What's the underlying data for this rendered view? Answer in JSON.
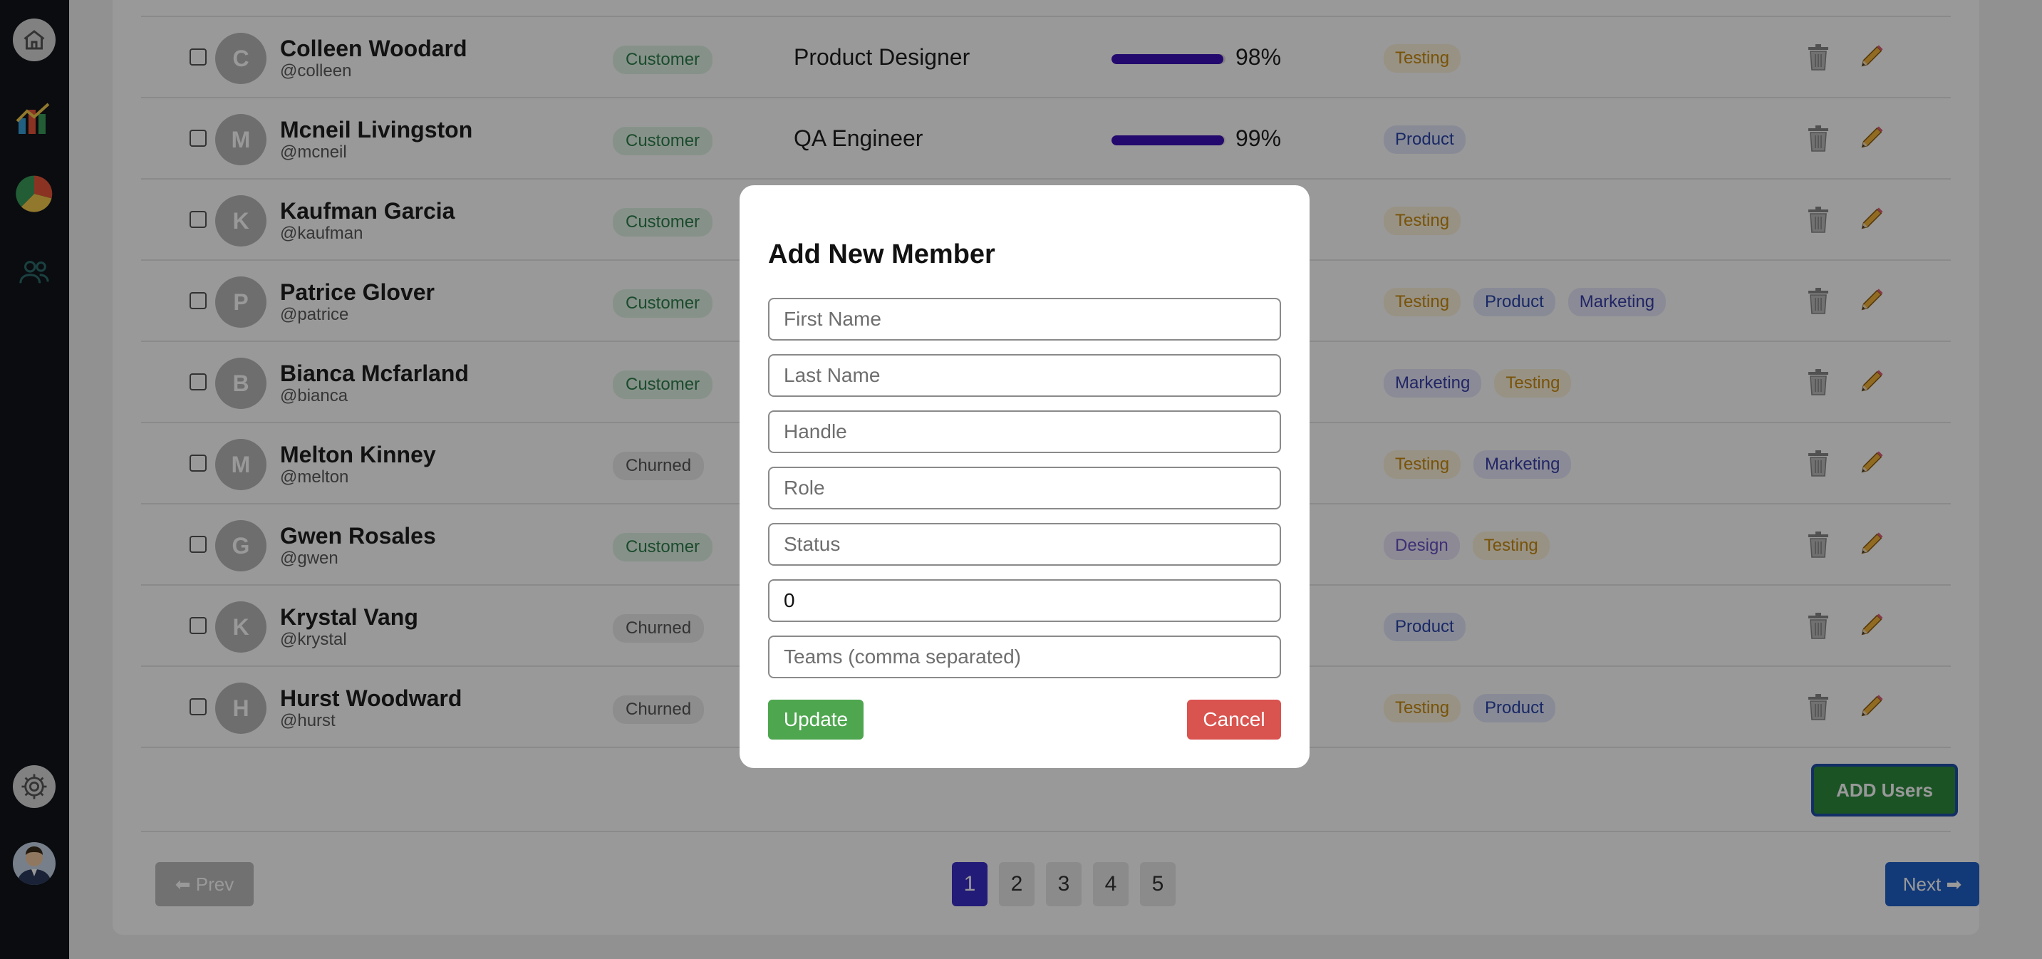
{
  "sidebar": {
    "icons": [
      "home-icon",
      "bar-chart-icon",
      "pie-chart-icon",
      "users-icon",
      "gear-icon",
      "user-avatar"
    ]
  },
  "table": {
    "rows": [
      {
        "initial": "C",
        "name": "Colleen Woodard",
        "handle": "@colleen",
        "status": "Customer",
        "role": "Product Designer",
        "progress": 98,
        "progress_label": "98%",
        "teams": [
          "Testing"
        ]
      },
      {
        "initial": "M",
        "name": "Mcneil Livingston",
        "handle": "@mcneil",
        "status": "Customer",
        "role": "QA Engineer",
        "progress": 99,
        "progress_label": "99%",
        "teams": [
          "Product"
        ]
      },
      {
        "initial": "K",
        "name": "Kaufman Garcia",
        "handle": "@kaufman",
        "status": "Customer",
        "role": "",
        "progress": null,
        "progress_label": "",
        "teams": [
          "Testing"
        ]
      },
      {
        "initial": "P",
        "name": "Patrice Glover",
        "handle": "@patrice",
        "status": "Customer",
        "role": "",
        "progress": null,
        "progress_label": "",
        "teams": [
          "Testing",
          "Product",
          "Marketing"
        ]
      },
      {
        "initial": "B",
        "name": "Bianca Mcfarland",
        "handle": "@bianca",
        "status": "Customer",
        "role": "",
        "progress": null,
        "progress_label": "",
        "teams": [
          "Marketing",
          "Testing"
        ]
      },
      {
        "initial": "M",
        "name": "Melton Kinney",
        "handle": "@melton",
        "status": "Churned",
        "role": "",
        "progress": null,
        "progress_label": "",
        "teams": [
          "Testing",
          "Marketing"
        ]
      },
      {
        "initial": "G",
        "name": "Gwen Rosales",
        "handle": "@gwen",
        "status": "Customer",
        "role": "",
        "progress": null,
        "progress_label": "",
        "teams": [
          "Design",
          "Testing"
        ]
      },
      {
        "initial": "K",
        "name": "Krystal Vang",
        "handle": "@krystal",
        "status": "Churned",
        "role": "",
        "progress": null,
        "progress_label": "",
        "teams": [
          "Product"
        ]
      },
      {
        "initial": "H",
        "name": "Hurst Woodward",
        "handle": "@hurst",
        "status": "Churned",
        "role": "",
        "progress": null,
        "progress_label": "",
        "teams": [
          "Testing",
          "Product"
        ]
      }
    ]
  },
  "actions": {
    "add_users": "ADD Users"
  },
  "pagination": {
    "prev": "⬅ Prev",
    "next": "Next ➡",
    "pages": [
      "1",
      "2",
      "3",
      "4",
      "5"
    ],
    "active_page": "1"
  },
  "modal": {
    "title": "Add New Member",
    "fields": {
      "first_name": {
        "placeholder": "First Name",
        "value": ""
      },
      "last_name": {
        "placeholder": "Last Name",
        "value": ""
      },
      "handle": {
        "placeholder": "Handle",
        "value": ""
      },
      "role": {
        "placeholder": "Role",
        "value": ""
      },
      "status": {
        "placeholder": "Status",
        "value": ""
      },
      "progress": {
        "placeholder": "",
        "value": "0"
      },
      "teams": {
        "placeholder": "Teams (comma separated)",
        "value": ""
      }
    },
    "update_label": "Update",
    "cancel_label": "Cancel"
  },
  "colors": {
    "sidebar_bg": "#12141c",
    "progress_fill": "#3b0fb8",
    "update_button": "#4ea64f",
    "cancel_button": "#d9534f",
    "add_users_button": "#2e8b3e",
    "next_button": "#1e5fc8",
    "active_page": "#3b2ec8"
  }
}
